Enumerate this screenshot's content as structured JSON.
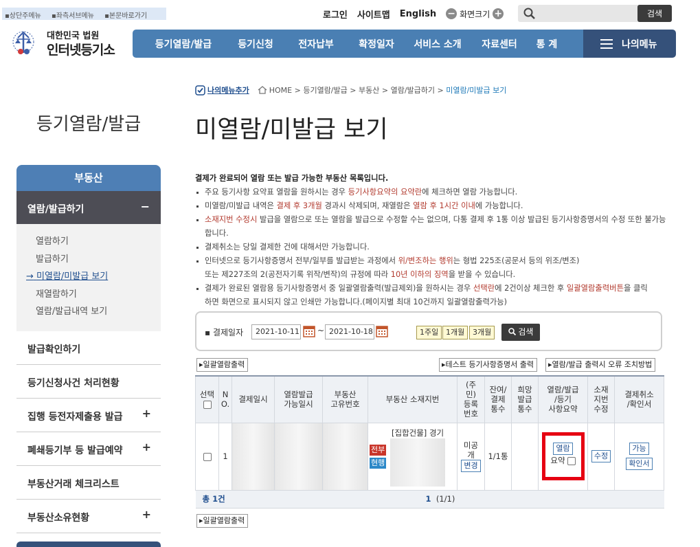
{
  "skip_links": [
    "상단주메뉴",
    "좌측서브메뉴",
    "본문바로가기"
  ],
  "logo": {
    "line1": "대한민국 법원",
    "line2": "인터넷등기소"
  },
  "util": {
    "login": "로그인",
    "sitemap": "사이트맵",
    "english": "English",
    "zoom_label": "화면크기",
    "zoom_out": "−",
    "zoom_in": "+"
  },
  "search": {
    "placeholder": "",
    "button": "검색"
  },
  "gnb": [
    "등기열람/발급",
    "등기신청",
    "전자납부",
    "확정일자",
    "서비스 소개",
    "자료센터",
    "통 계"
  ],
  "my_menu": "나의메뉴",
  "lnb": {
    "title": "등기열람/발급",
    "head": "부동산",
    "sub": "열람/발급하기",
    "sub_toggle": "−",
    "items": [
      "열람하기",
      "발급하기",
      "미열람/미발급 보기",
      "재열람하기",
      "열람/발급내역 보기"
    ],
    "active_prefix": "→",
    "menus": [
      {
        "label": "발급확인하기",
        "toggle": ""
      },
      {
        "label": "등기신청사건 처리현황",
        "toggle": ""
      },
      {
        "label": "집행 등전자제출용 발급",
        "toggle": "+"
      },
      {
        "label": "폐쇄등기부 등 발급예약",
        "toggle": "+"
      },
      {
        "label": "부동산거래 체크리스트",
        "toggle": ""
      },
      {
        "label": "부동산소유현황",
        "toggle": "+"
      }
    ]
  },
  "breadcrumb": {
    "add_my": "나의메뉴추가",
    "path": [
      "HOME",
      "등기열람/발급",
      "부동산",
      "열람/발급하기"
    ],
    "current": "미열람/미발급 보기",
    "sep": ">"
  },
  "page_title": "미열람/미발급 보기",
  "info": {
    "lead": "결제가 완료되어 열람 또는 발급 가능한 부동산 목록입니다.",
    "r1": [
      "주요 등기사항 요약표 열람을 원하시는 경우 ",
      "등기사항요약의 요약란",
      "에 체크하면 열람 가능합니다."
    ],
    "r2": [
      "미열람/미발급 내역은 ",
      "결제 후 3개월",
      " 경과시 삭제되며, 재열람은 ",
      "열람 후 1시간 이내",
      "에 가능합니다."
    ],
    "r3a": [
      "소재지번 수정시",
      " 발급을 열람으로 또는 열람을 발급으로 수정할 수는 없으며, 다통 결제 후 1통 이상 발급된 등기사항증명서의 수정 또한 불가능"
    ],
    "r3b": "합니다.",
    "r4": "결제취소는 당일 결제한 건에 대해서만 가능합니다.",
    "r5a": [
      "인터넷으로 등기사항증명서 전부/일부를 발급받는 과정에서 ",
      "위/변조하는 행위",
      "는 형법 225조(공문서 등의 위조/변조)"
    ],
    "r5b": [
      "또는 제227조의 2(공전자기록 위작/변작)의 규정에 따라 ",
      "10년 이하의 징역",
      "을 받을 수 있습니다."
    ],
    "r6a": [
      "결제가 완료된 열람용 등기사항증명서 중 일괄열람출력(발급제외)을 원하시는 경우 ",
      "선택란",
      "에 2건이상 체크한 후 ",
      "일괄열람출력버튼",
      "을 클릭"
    ],
    "r6b": "하면 화면으로 표시되지 않고 인쇄만 가능합니다.(페이지별 최대 10건까지 일괄열람출력가능)"
  },
  "date_search": {
    "label": "결제일자",
    "from": "2021-10-11",
    "tilde": "~",
    "to": "2021-10-18",
    "periods": [
      "1주일",
      "1개월",
      "3개월"
    ],
    "button": "검색"
  },
  "buttons": {
    "bulk_print": "일괄열람출력",
    "test_print": "테스트 등기사항증명서 출력",
    "error_fix": "열람/발급 출력시 오류 조치방법"
  },
  "table": {
    "headers": [
      "선택",
      "N\nO.",
      "결제일시",
      "열람발급\n가능일시",
      "부동산\n고유번호",
      "부동산 소재지번",
      "(주\n민)\n등록\n번호",
      "잔여/\n결제\n통수",
      "희망\n발급\n통수",
      "열람/발급\n/등기\n사항요약",
      "소재\n지번\n수정",
      "결제취소\n/확인서"
    ],
    "row": {
      "no": "1",
      "tag_all": "전부",
      "tag_current": "현행",
      "address": "[집합건물] 경기",
      "id_status": "미공\n개",
      "id_change": "변경",
      "remaining": "1/1통",
      "desired": "",
      "view_button": "열람",
      "summary_label": "요약",
      "edit_button": "수정",
      "cancel_button": "가능",
      "certificate_button": "확인서"
    },
    "total": "총 1건",
    "paging": {
      "current": "1",
      "text": "(1/1)"
    }
  },
  "colors": {
    "gnb": "#4a7fb3",
    "my_menu": "#35517a",
    "highlight": "#e60012",
    "tag_all": "#c9352a",
    "tag_current": "#2b88c8"
  }
}
